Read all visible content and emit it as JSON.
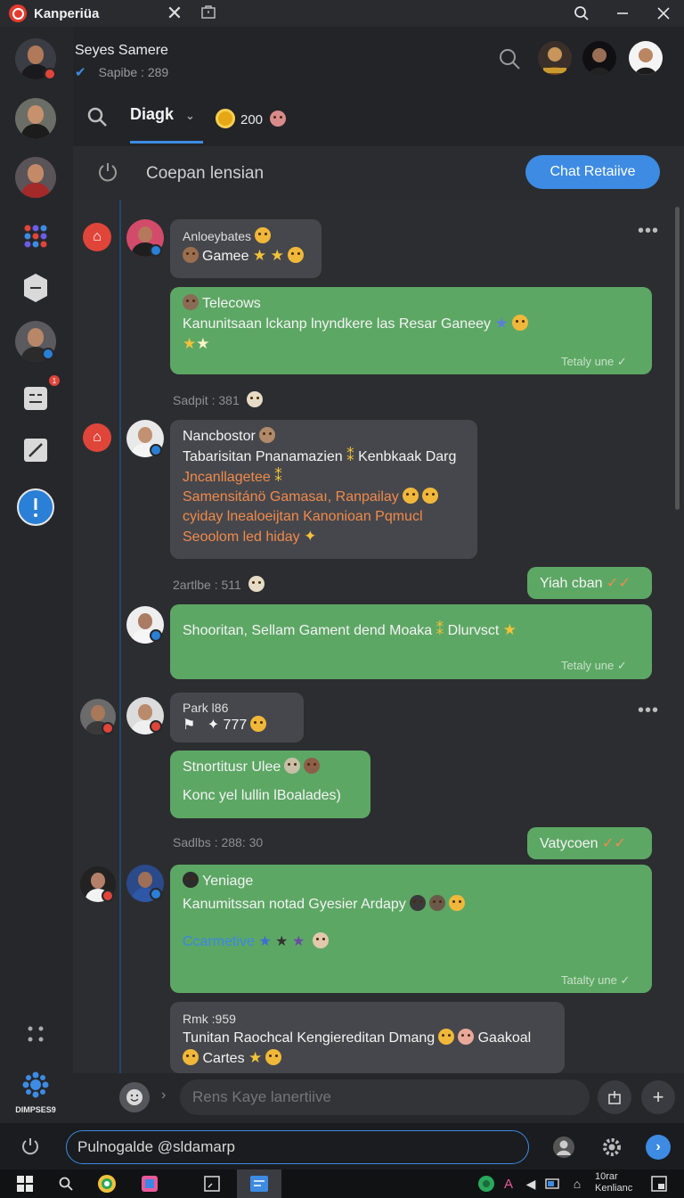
{
  "window": {
    "app_name": "Kanperiüa",
    "close_glyph": "✕"
  },
  "header": {
    "user_name": "Seyes Samere",
    "user_status": "Sapibe : 289",
    "active_tab": "Diagk",
    "coin_count": "200"
  },
  "channel": {
    "title": "Coepan lensian",
    "action_button": "Chat Retaiive"
  },
  "messages": [
    {
      "side": "left",
      "color": "gray",
      "author": "Anloeybates",
      "lines": [
        "Gamee"
      ]
    },
    {
      "side": "left",
      "color": "green",
      "author": "Telecows",
      "lines": [
        "Kanunitsaan lckanp lnyndkere las Resar Ganeey"
      ],
      "meta": "Tetaly une"
    },
    {
      "timestamp": "Sadpit : 381"
    },
    {
      "side": "left",
      "color": "gray",
      "author": "Nancbostor",
      "lines": [
        "Tabarisitan Pnanamazien",
        "Kenbkaak Darg",
        "Jncanllagetee",
        "Samensitánö Gamasaı, Ranpailay",
        "cyiday lnealoeijtan Kanonioan Pqmucl",
        "Seoolom led hiday"
      ]
    },
    {
      "timestamp": "2artlbe : 511"
    },
    {
      "side": "right",
      "color": "green",
      "lines": [
        "Yiah cban"
      ]
    },
    {
      "side": "left",
      "color": "green",
      "lines": [
        "Shooritan, Sellam Gament dend Moaka",
        "Dlurvsct"
      ],
      "meta": "Tetaly une"
    },
    {
      "side": "left",
      "color": "gray",
      "author": "Park l86",
      "lines": [
        "777"
      ]
    },
    {
      "side": "left",
      "color": "green",
      "lines": [
        "Stnortitusr Ulee",
        "Konc yel lullin lBoalades)"
      ]
    },
    {
      "timestamp": "Sadlbs : 288: 30"
    },
    {
      "side": "right",
      "color": "green",
      "lines": [
        "Vatycoen"
      ]
    },
    {
      "side": "left",
      "color": "green",
      "author": "Yeniage",
      "lines": [
        "Kanumitssan notad Gyesier Ardapy",
        "Ccarmetive"
      ],
      "meta": "Tatalty une"
    },
    {
      "side": "left",
      "color": "gray",
      "author": "Rmk :959",
      "lines": [
        "Tunitan Raochcal Kengiereditan Dmang",
        "Gaakoal",
        "Cartes"
      ]
    }
  ],
  "composer": {
    "placeholder": "Rens Kaye lanertiive"
  },
  "bottom_search": {
    "value": "Pulnogalde @sldamarp"
  },
  "taskbar": {
    "clock_line1": "10rar",
    "clock_line2": "Kenlianc"
  },
  "rail": {
    "label": "DIMPSES9",
    "notification_count": "1"
  },
  "colors": {
    "accent": "#3d8be3",
    "bubble_green": "#5da765",
    "bubble_gray": "#46474c",
    "alert_red": "#e0453a"
  }
}
